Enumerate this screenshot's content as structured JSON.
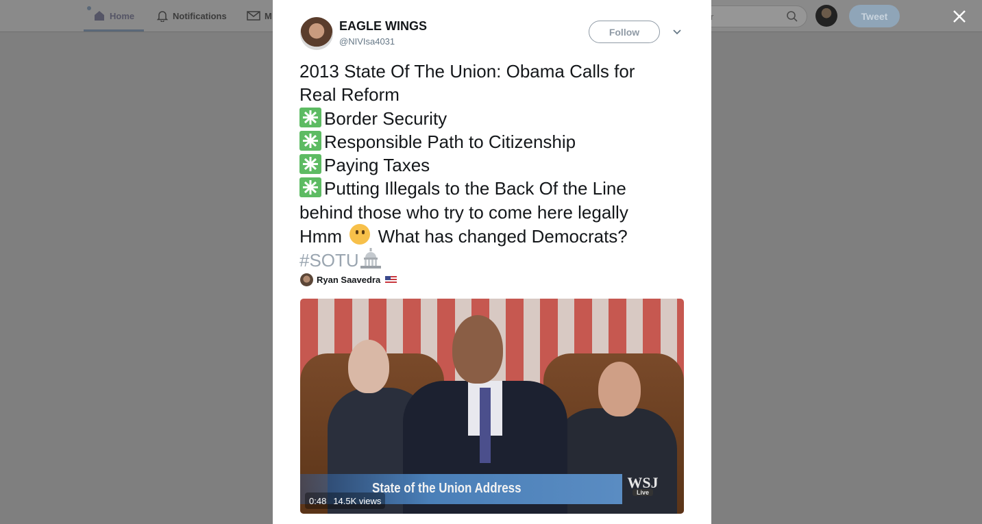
{
  "nav": {
    "home_label": "Home",
    "notifications_label": "Notifications",
    "messages_label": "M",
    "search_placeholder": "r",
    "tweet_button_label": "Tweet"
  },
  "tweet": {
    "author_name": "EAGLE WINGS",
    "author_handle": "@NIVIsa4031",
    "follow_label": "Follow",
    "lines": {
      "l1": "2013 State Of The Union: Obama Calls for",
      "l2": "Real Reform",
      "l3": "Border Security",
      "l4": "Responsible Path to Citizenship",
      "l5": "Paying Taxes",
      "l6": "Putting Illegals to the Back Of the Line",
      "l7": "behind those who try to come here legally",
      "l8a": "Hmm",
      "l8b": "What has changed Democrats?",
      "hashtag": "#SOTU"
    },
    "mention_name": "Ryan Saavedra",
    "video": {
      "caption": "State of the Union Address",
      "brand": "WSJ",
      "brand_sub": "Live",
      "duration": "0:48",
      "views": "14.5K views"
    }
  },
  "colors": {
    "overlay": "#7f7f7f",
    "bullet_green": "#5dbb63",
    "hashtag": "#9aa5b0",
    "follow_border": "#8f9aa5"
  },
  "icons": [
    "home-icon",
    "bell-icon",
    "envelope-icon",
    "search-icon",
    "close-icon",
    "chevron-down-icon",
    "eight-spoked-asterisk-icon",
    "thinking-face-icon",
    "capitol-building-icon",
    "us-flag-icon"
  ]
}
